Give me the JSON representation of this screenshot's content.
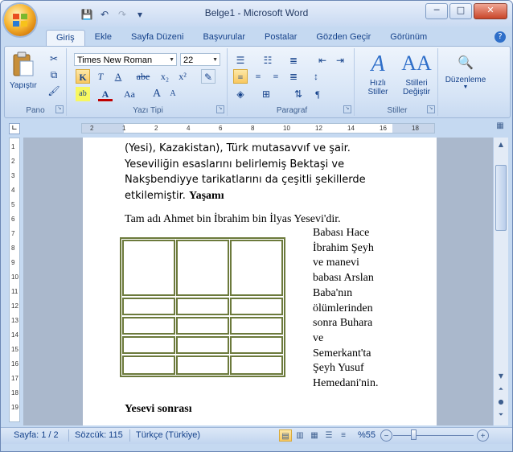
{
  "window": {
    "title": "Belge1 - Microsoft Word",
    "minimize": "─",
    "maximize": "□",
    "close": "✕"
  },
  "qat": {
    "save": "💾",
    "undo": "↶",
    "redo": "↷",
    "customize": "▾"
  },
  "tabs": [
    "Giriş",
    "Ekle",
    "Sayfa Düzeni",
    "Başvurular",
    "Postalar",
    "Gözden Geçir",
    "Görünüm"
  ],
  "active_tab": "Giriş",
  "ribbon": {
    "clipboard": {
      "label": "Pano",
      "paste": "Yapıştır"
    },
    "font": {
      "label": "Yazı Tipi",
      "family": "Times New Roman",
      "size": "22",
      "bold": "K",
      "italic": "T",
      "underline": "A",
      "strike": "abe",
      "sub": "x₂",
      "sup": "x²",
      "grow": "A",
      "shrink": "A",
      "case": "Aa",
      "color": "A",
      "highlight": "ab"
    },
    "paragraph": {
      "label": "Paragraf"
    },
    "styles": {
      "label": "Stiller",
      "quick": "Hızlı\nStiller",
      "quick1": "Hızlı",
      "quick2": "Stiller",
      "change1": "Stilleri",
      "change2": "Değiştir"
    },
    "editing": {
      "label": "Düzenleme"
    }
  },
  "ruler": {
    "hticks": [
      "2",
      "1",
      "2",
      "4",
      "6",
      "8",
      "10",
      "12",
      "14",
      "16",
      "18"
    ],
    "vticks": [
      "1",
      "2",
      "3",
      "4",
      "5",
      "6",
      "7",
      "8",
      "9",
      "10",
      "11",
      "12",
      "13",
      "14",
      "15",
      "16",
      "17",
      "18",
      "19"
    ]
  },
  "document": {
    "lines_top": [
      "(Yesi), Kazakistan), Türk mutasavvıf ve şair.",
      "Yeseviliğin esaslarını belirlemiş Bektaşi ve",
      "Nakşbendiyye tarikatlarını da çeşitli şekillerde"
    ],
    "line4_text": "etkilemiştir. ",
    "heading1": "Yaşamı",
    "para2": "Tam adı Ahmet bin İbrahim bin İlyas Yesevi'dir.",
    "right_col": [
      "Babası Hace",
      "İbrahim Şeyh",
      "ve manevi",
      "babası Arslan",
      "Baba'nın",
      "ölümlerinden",
      "sonra Buhara",
      "ve",
      "Semerkant'ta",
      "Şeyh Yusuf",
      "Hemedani'nin."
    ],
    "heading2": "Yesevi sonrası"
  },
  "status": {
    "page": "Sayfa: 1 / 2",
    "words": "Sözcük: 115",
    "language": "Türkçe (Türkiye)",
    "zoom": "%55",
    "zoom_out": "−",
    "zoom_in": "+"
  }
}
